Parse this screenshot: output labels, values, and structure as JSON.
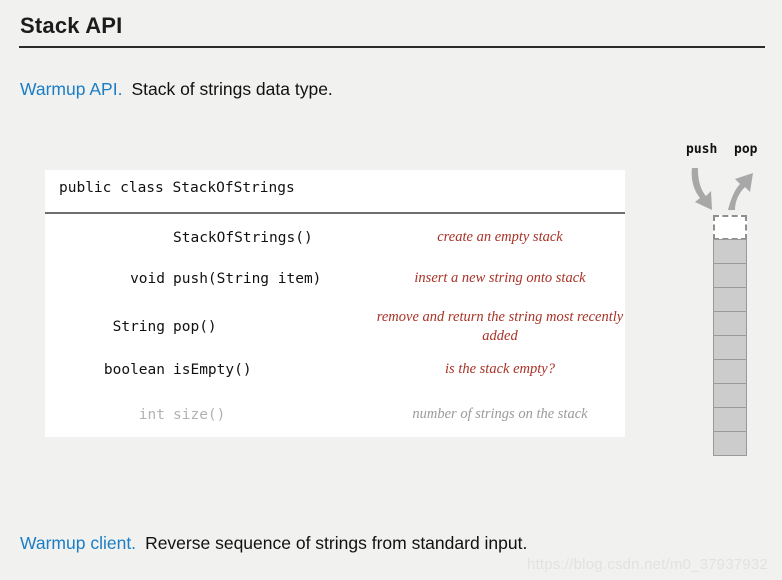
{
  "slide": {
    "title": "Stack API",
    "lead": {
      "accent": "Warmup API.",
      "rest": "Stack of strings data type."
    },
    "closing": {
      "accent": "Warmup client.",
      "rest": "Reverse sequence of strings from standard input."
    }
  },
  "api_card": {
    "class_declaration": "public class StackOfStrings",
    "rows": [
      {
        "return_type": "",
        "signature": "StackOfStrings()",
        "description": "create an empty stack",
        "muted": false
      },
      {
        "return_type": "void",
        "signature": "push(String item)",
        "description": "insert a new string onto stack",
        "muted": false
      },
      {
        "return_type": "String",
        "signature": "pop()",
        "description": "remove and return the string most recently added",
        "muted": false
      },
      {
        "return_type": "boolean",
        "signature": "isEmpty()",
        "description": "is the stack empty?",
        "muted": false
      },
      {
        "return_type": "int",
        "signature": "size()",
        "description": "number of strings on the stack",
        "muted": true
      }
    ]
  },
  "stack_figure": {
    "push_label": "push",
    "pop_label": "pop",
    "empty_cells": 1,
    "filled_cells": 9
  },
  "watermark": {
    "text": "https://blog.csdn.net/m0_37937932"
  },
  "colors": {
    "background": "#f1f1f0",
    "accent_blue": "#1b7ec4",
    "description_red": "#a93226",
    "muted_gray": "#9a9a9a",
    "cell_fill": "#cccccc",
    "arrow_gray": "#a8a8a8"
  }
}
